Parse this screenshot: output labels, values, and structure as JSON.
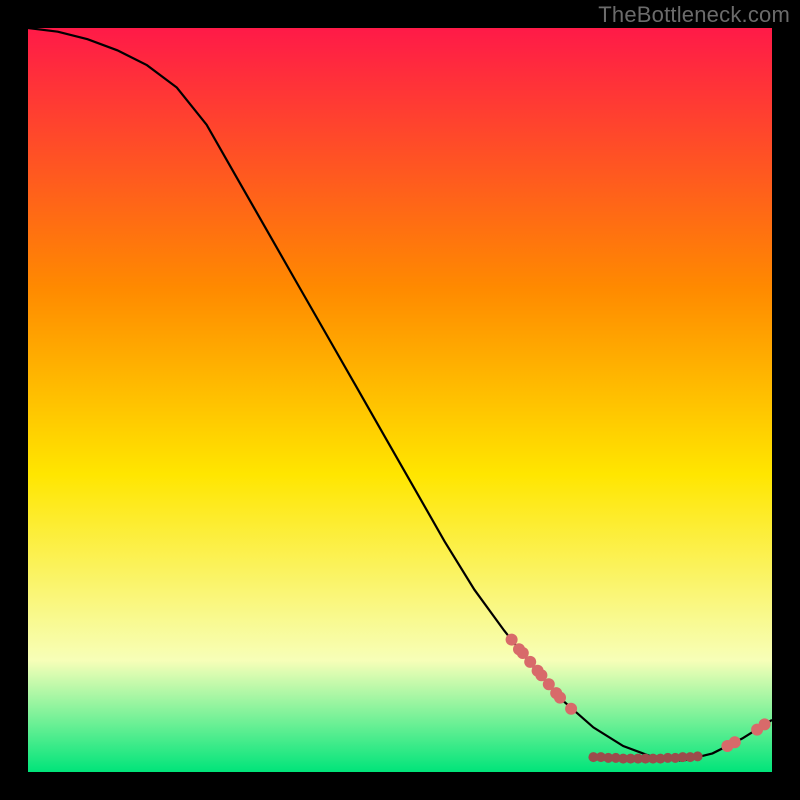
{
  "watermark": "TheBottleneck.com",
  "colors": {
    "bg": "#000000",
    "grad_top": "#ff1a48",
    "grad_mid1": "#ff8a00",
    "grad_mid2": "#ffe600",
    "grad_low": "#f7ffb8",
    "grad_bottom": "#00e47a",
    "curve": "#000000",
    "marker": "#d86a6a"
  },
  "chart_data": {
    "type": "line",
    "title": "",
    "xlabel": "",
    "ylabel": "",
    "xlim": [
      0,
      100
    ],
    "ylim": [
      0,
      100
    ],
    "series": [
      {
        "name": "curve",
        "x": [
          0,
          4,
          8,
          12,
          16,
          20,
          24,
          28,
          32,
          36,
          40,
          44,
          48,
          52,
          56,
          60,
          64,
          68,
          72,
          76,
          80,
          84,
          88,
          92,
          96,
          100
        ],
        "y": [
          100,
          99.5,
          98.5,
          97,
          95,
          92,
          87,
          80,
          73,
          66,
          59,
          52,
          45,
          38,
          31,
          24.5,
          19,
          14,
          9.5,
          6,
          3.5,
          2,
          1.5,
          2.5,
          4.5,
          7
        ]
      }
    ],
    "markers_pink": [
      {
        "x": 65,
        "y": 17.8
      },
      {
        "x": 66,
        "y": 16.5
      },
      {
        "x": 66.5,
        "y": 16.0
      },
      {
        "x": 67.5,
        "y": 14.8
      },
      {
        "x": 68.5,
        "y": 13.6
      },
      {
        "x": 69,
        "y": 13.0
      },
      {
        "x": 70,
        "y": 11.8
      },
      {
        "x": 71,
        "y": 10.6
      },
      {
        "x": 71.5,
        "y": 10.0
      },
      {
        "x": 73,
        "y": 8.5
      },
      {
        "x": 94,
        "y": 3.5
      },
      {
        "x": 95,
        "y": 4.0
      },
      {
        "x": 98,
        "y": 5.7
      },
      {
        "x": 99,
        "y": 6.4
      }
    ],
    "markers_dark": [
      {
        "x": 76,
        "y": 2.0
      },
      {
        "x": 77,
        "y": 2.0
      },
      {
        "x": 78,
        "y": 1.9
      },
      {
        "x": 79,
        "y": 1.9
      },
      {
        "x": 80,
        "y": 1.8
      },
      {
        "x": 81,
        "y": 1.8
      },
      {
        "x": 82,
        "y": 1.8
      },
      {
        "x": 83,
        "y": 1.8
      },
      {
        "x": 84,
        "y": 1.8
      },
      {
        "x": 85,
        "y": 1.8
      },
      {
        "x": 86,
        "y": 1.9
      },
      {
        "x": 87,
        "y": 1.9
      },
      {
        "x": 88,
        "y": 2.0
      },
      {
        "x": 89,
        "y": 2.0
      },
      {
        "x": 90,
        "y": 2.1
      }
    ]
  }
}
